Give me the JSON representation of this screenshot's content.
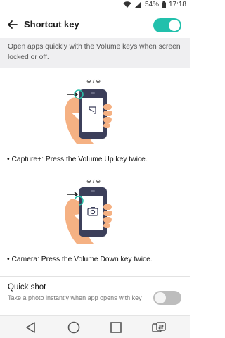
{
  "status_bar": {
    "battery": "54%",
    "time": "17:18"
  },
  "header": {
    "title": "Shortcut key",
    "toggle_on": true
  },
  "description": "Open apps quickly with the Volume keys when screen locked or off.",
  "illustrations": [
    {
      "key_label": "⊕ / ⊖",
      "action_icon": "capture-plus-icon"
    },
    {
      "key_label": "⊕ / ⊖",
      "action_icon": "camera-icon"
    }
  ],
  "bullets": [
    "• Capture+: Press the Volume Up key twice.",
    "• Camera: Press the Volume Down key twice."
  ],
  "quick_shot": {
    "title": "Quick shot",
    "subtitle": "Take a photo instantly when app opens with key",
    "toggle_on": false
  },
  "nav": [
    "back-icon",
    "home-icon",
    "recents-icon",
    "switch-sim-icon"
  ],
  "colors": {
    "accent": "#22c0ac",
    "skin": "#f5b183",
    "phone": "#3c3f5a",
    "highlight": "#2bc0a9"
  }
}
